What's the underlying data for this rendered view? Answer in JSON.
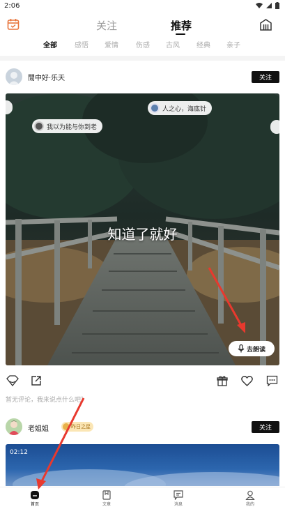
{
  "status_bar": {
    "time": "2:06"
  },
  "top_nav": {
    "tabs": [
      {
        "label": "关注",
        "active": false
      },
      {
        "label": "推荐",
        "active": true
      }
    ]
  },
  "categories": [
    "全部",
    "感悟",
    "爱情",
    "伤感",
    "古风",
    "经典",
    "亲子"
  ],
  "post1": {
    "username": "閒中好·乐天",
    "follow_label": "关注",
    "tag_left": "我以为能与你到老",
    "tag_right": "人之心，海底针",
    "overlay_text": "知道了就好",
    "read_button": "去朗读",
    "comment_prompt": "暂无评论，我来说点什么吧》"
  },
  "post2": {
    "username": "老姐姐",
    "badge": "昨日之星",
    "follow_label": "关注",
    "duration": "02:12"
  },
  "bottom_nav": [
    {
      "label": "首页",
      "icon": "home-icon",
      "active": true
    },
    {
      "label": "文章",
      "icon": "article-icon",
      "active": false
    },
    {
      "label": "消息",
      "icon": "message-icon",
      "active": false
    },
    {
      "label": "我的",
      "icon": "profile-icon",
      "active": false
    }
  ],
  "colors": {
    "accent": "#111111",
    "annotation": "#e8392e",
    "calendar": "#e8743b"
  }
}
